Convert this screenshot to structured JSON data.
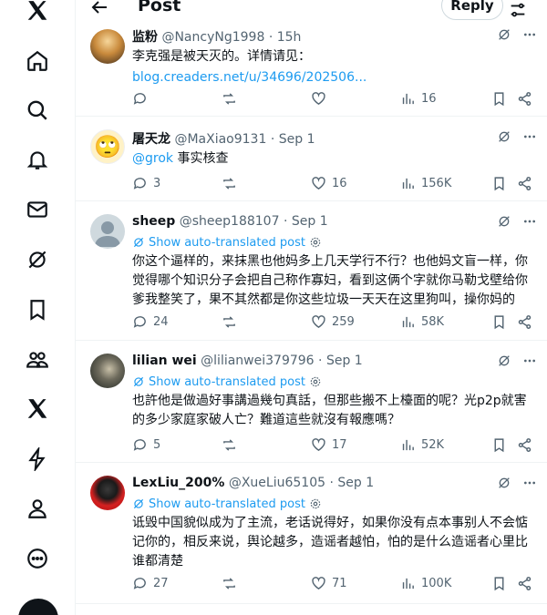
{
  "header": {
    "title": "Post",
    "reply_label": "Reply"
  },
  "sidebar": {
    "items": [
      {
        "icon": "x-logo-icon"
      },
      {
        "icon": "home-icon"
      },
      {
        "icon": "search-icon"
      },
      {
        "icon": "bell-icon"
      },
      {
        "icon": "mail-icon"
      },
      {
        "icon": "grok-icon"
      },
      {
        "icon": "bookmark-icon"
      },
      {
        "icon": "communities-icon"
      },
      {
        "icon": "premium-x-icon"
      },
      {
        "icon": "lightning-icon"
      },
      {
        "icon": "profile-icon"
      },
      {
        "icon": "more-icon"
      }
    ]
  },
  "translate_label": "Show auto-translated post",
  "tweets": [
    {
      "name": "监粉",
      "handle": "@NancyNg1998",
      "dot": "·",
      "time": "15h",
      "text": "李克强是被天灭的。详情请见：",
      "link": "blog.creaders.net/u/34696/202506...",
      "replies": "",
      "retweets": "",
      "likes": "",
      "views": "16"
    },
    {
      "name": "屠天龙",
      "handle": "@MaXiao9131",
      "dot": "·",
      "time": "Sep 1",
      "mention": "@grok",
      "text": " 事实核查",
      "replies": "3",
      "retweets": "",
      "likes": "16",
      "views": "156K"
    },
    {
      "name": "sheep",
      "handle": "@sheep188107",
      "dot": "·",
      "time": "Sep 1",
      "text": "你这个逼样的，来抹黑也他妈多上几天学行不行？也他妈文盲一样，你觉得哪个知识分子会把自己称作寡妇，看到这俩个字就你马勒戈壁给你爹我整笑了，果不其然都是你这些垃圾一天天在这里狗叫，操你妈的",
      "replies": "24",
      "retweets": "",
      "likes": "259",
      "views": "58K"
    },
    {
      "name": "lilian wei",
      "handle": "@lilianwei379796",
      "dot": "·",
      "time": "Sep 1",
      "text": "也許他是做過好事講過幾句真話，但那些搬不上檯面的呢？光p2p就害的多少家庭家破人亡？難道這些就沒有報應嗎？",
      "replies": "5",
      "retweets": "",
      "likes": "17",
      "views": "52K"
    },
    {
      "name": "LexLiu_200%",
      "handle": "@XueLiu65105",
      "dot": "·",
      "time": "Sep 1",
      "text": "诋毁中国貌似成为了主流，老话说得好，如果你没有点本事别人不会惦记你的，相反来说，舆论越多，造谣者越怕，怕的是什么造谣者心里比谁都清楚",
      "replies": "27",
      "retweets": "",
      "likes": "71",
      "views": "100K"
    }
  ]
}
